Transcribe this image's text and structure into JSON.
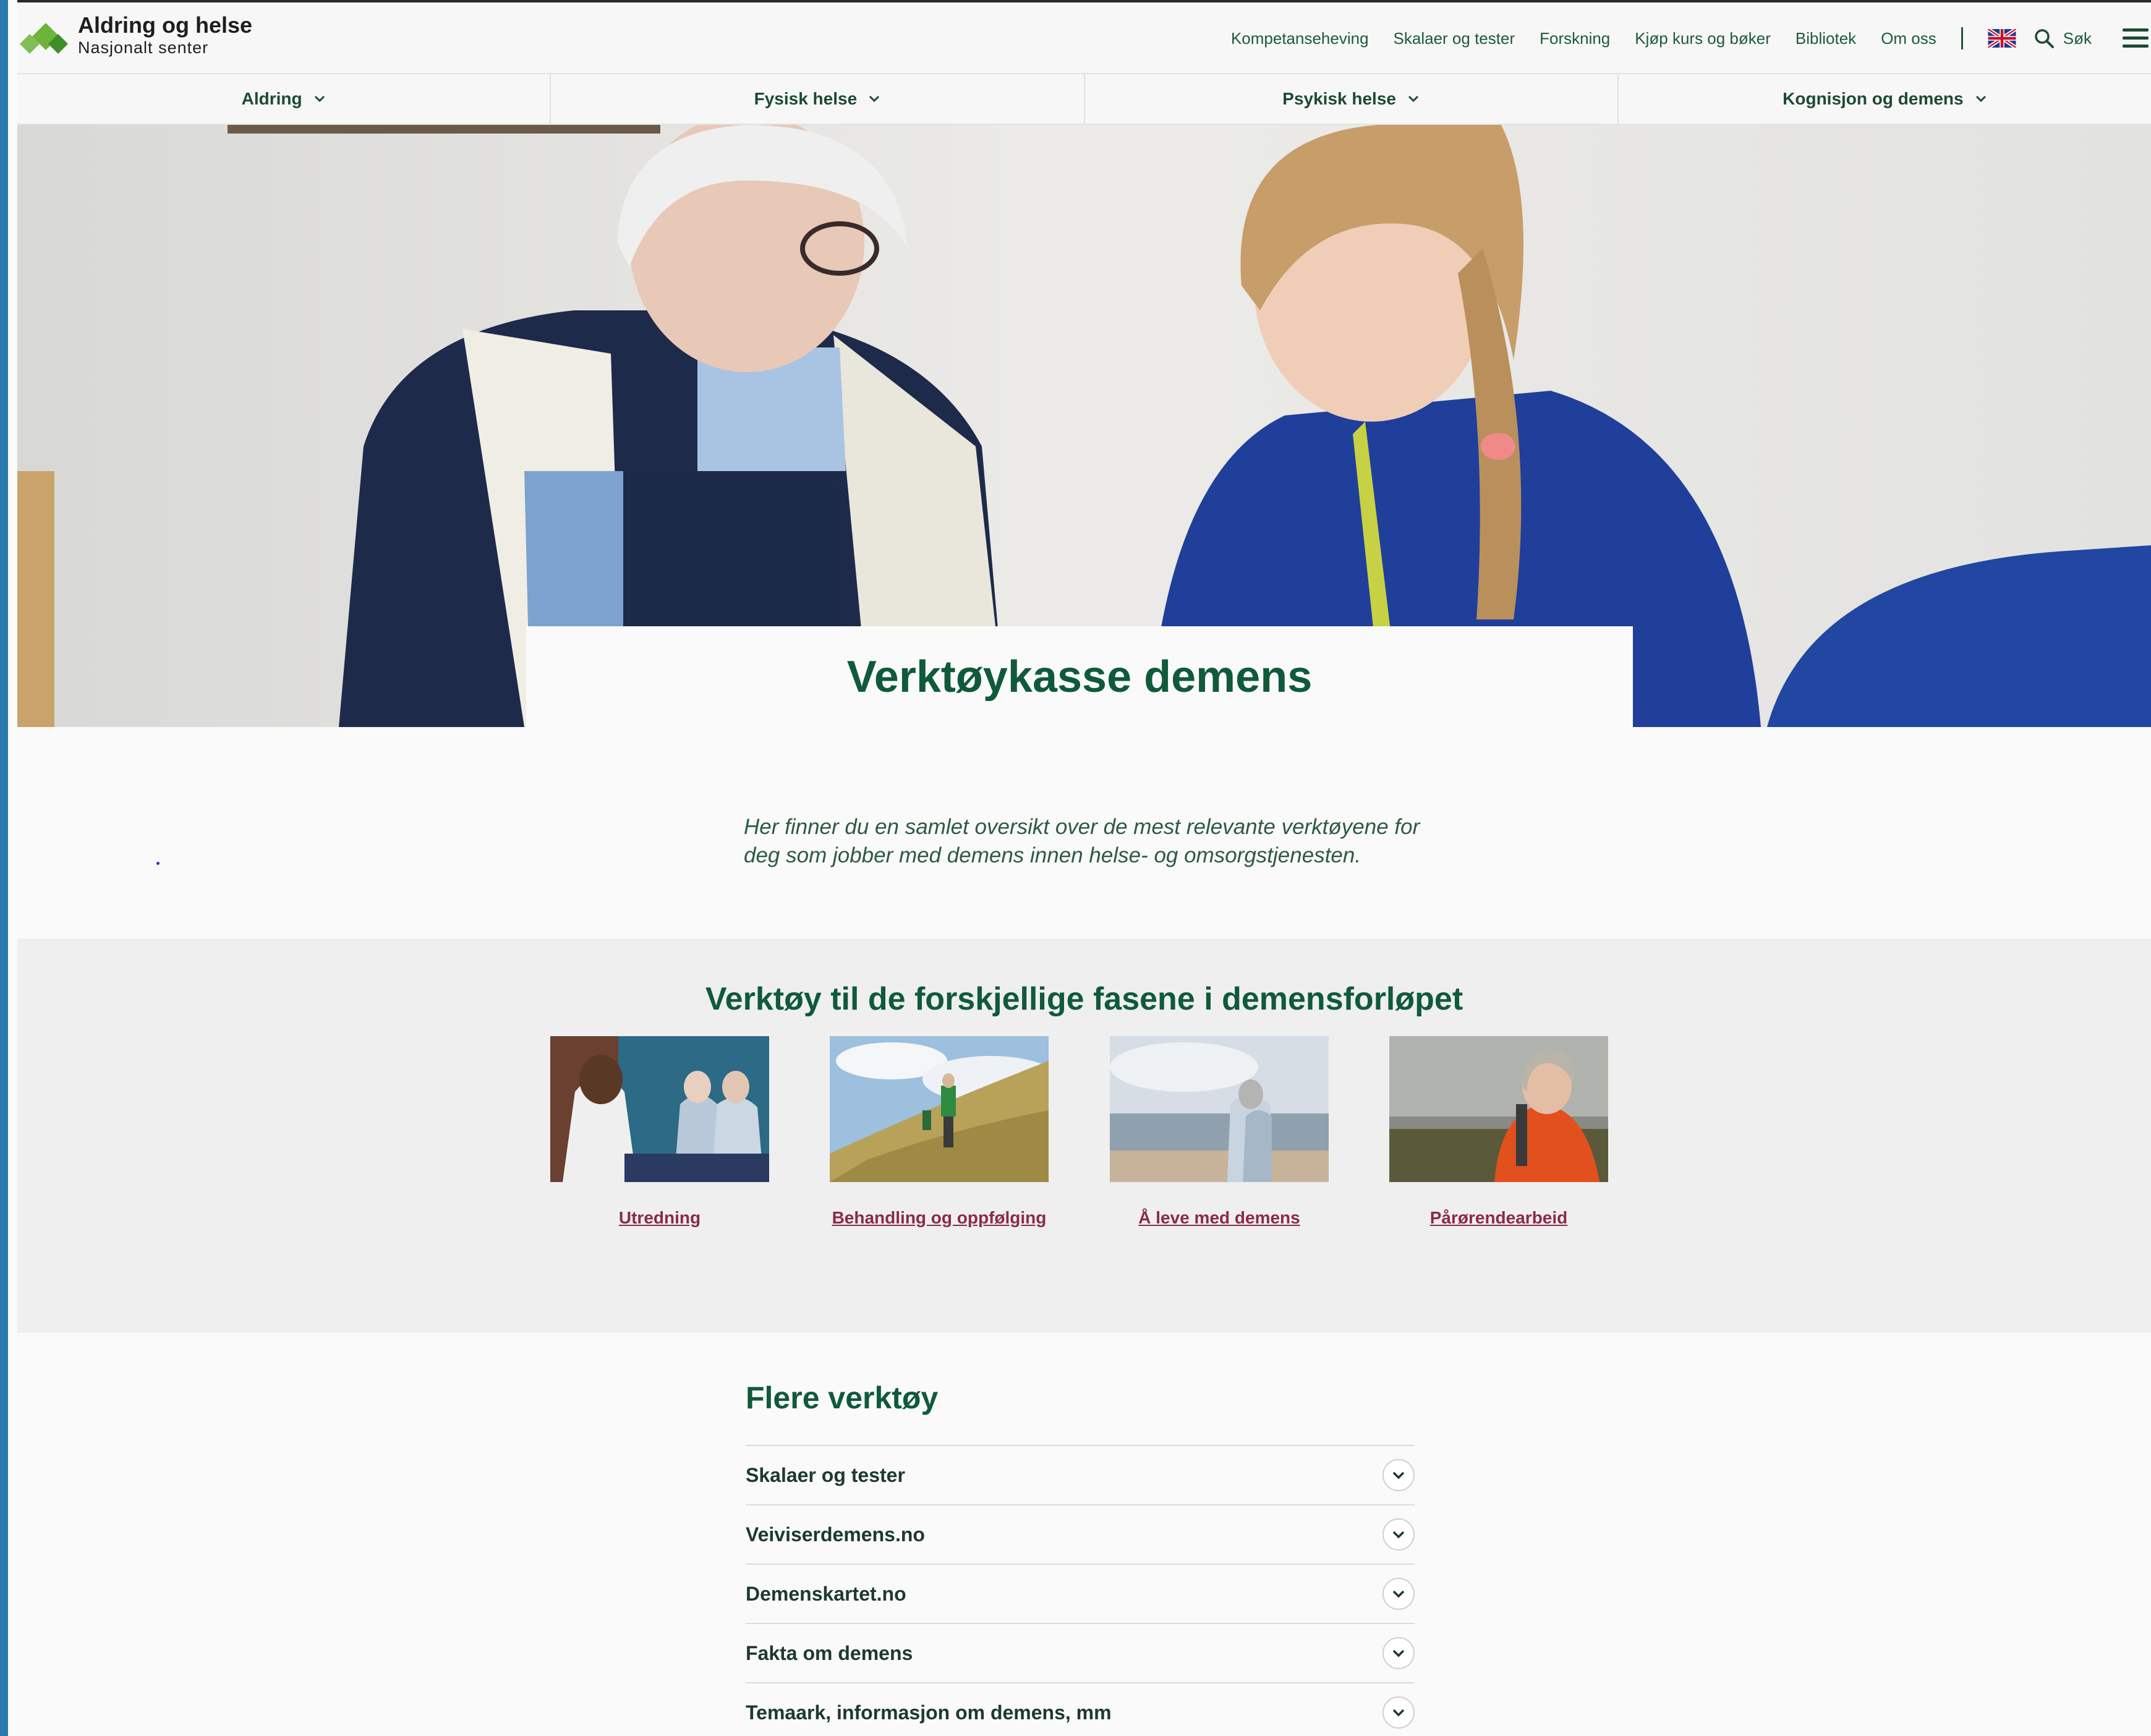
{
  "brand": {
    "name": "Aldring og helse",
    "subtitle": "Nasjonalt senter",
    "colors": {
      "green_dark": "#0f5a3a",
      "green_light": "#6fb33a",
      "link": "#8a2a4a"
    }
  },
  "topnav": {
    "links": [
      "Kompetanseheving",
      "Skalaer og tester",
      "Forskning",
      "Kjøp kurs og bøker",
      "Bibliotek",
      "Om oss"
    ],
    "language_icon": "uk-flag-icon",
    "search_label": "Søk",
    "menu_icon": "hamburger-menu-icon"
  },
  "mainnav": {
    "items": [
      "Aldring",
      "Fysisk helse",
      "Psykisk helse",
      "Kognisjon og demens"
    ]
  },
  "hero": {
    "title": "Verktøykasse demens"
  },
  "intro": {
    "text": "Her finner du en samlet oversikt over de mest relevante verktøyene for deg som jobber med demens innen helse- og omsorgstjenesten."
  },
  "phases": {
    "title": "Verktøy til de forskjellige fasene i demensforløpet",
    "cards": [
      {
        "label": "Utredning"
      },
      {
        "label": "Behandling og oppfølging"
      },
      {
        "label": "Å leve med demens"
      },
      {
        "label": "Pårørendearbeid"
      }
    ]
  },
  "more_tools": {
    "title": "Flere verktøy",
    "items": [
      "Skalaer og tester",
      "Veiviserdemens.no",
      "Demenskartet.no",
      "Fakta om demens",
      "Temaark, informasjon om demens, mm"
    ]
  }
}
